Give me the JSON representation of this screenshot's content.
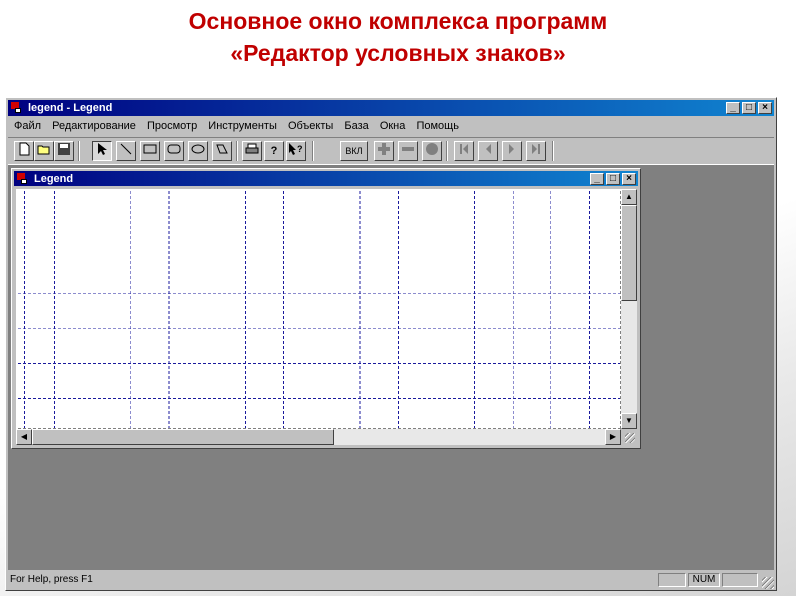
{
  "slide": {
    "title_line1": "Основное окно комплекса программ",
    "title_line2": "«Редактор условных знаков»"
  },
  "app": {
    "title": "legend - Legend",
    "menu": [
      "Файл",
      "Редактирование",
      "Просмотр",
      "Инструменты",
      "Объекты",
      "База",
      "Окна",
      "Помощь"
    ],
    "toolbar": {
      "vkl_label": "ВКЛ"
    }
  },
  "child": {
    "title": "Legend"
  },
  "status": {
    "help_text": "For Help, press F1",
    "num_indicator": "NUM"
  },
  "colors": {
    "title_red": "#c00000",
    "titlebar_blue": "#000080",
    "grid_line": "#1a1a9c"
  }
}
